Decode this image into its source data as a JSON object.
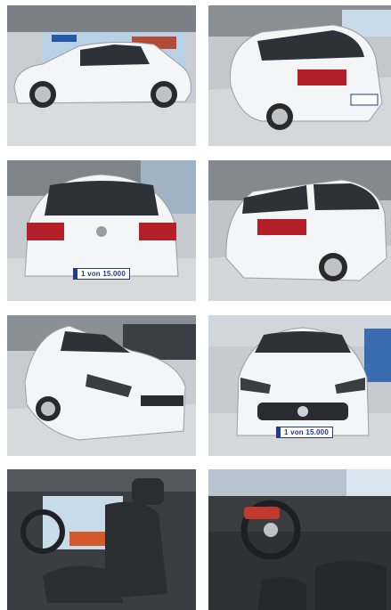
{
  "gallery": {
    "photos": [
      {
        "subject": "side-view"
      },
      {
        "subject": "rear-three-quarter-view"
      },
      {
        "subject": "rear-view",
        "plate_text": "1 von 15.000"
      },
      {
        "subject": "rear-quarter-view"
      },
      {
        "subject": "front-three-quarter-view"
      },
      {
        "subject": "front-view",
        "plate_text": "1 von 15.000"
      },
      {
        "subject": "interior-seats"
      },
      {
        "subject": "interior-dashboard"
      }
    ]
  },
  "colors": {
    "car_body": "#f4f5f6",
    "showroom_floor": "#d9dadb",
    "plate_blue": "#223a8a",
    "tail_light": "#b3202a",
    "interior_dark": "#2b2d30"
  }
}
